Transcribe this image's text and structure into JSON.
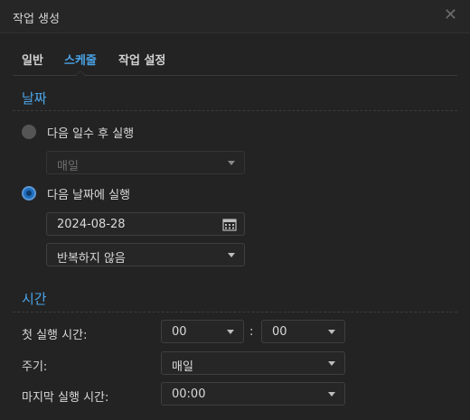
{
  "dialog": {
    "title": "작업 생성",
    "close_glyph": "✕"
  },
  "tabs": [
    {
      "label": "일반",
      "active": false
    },
    {
      "label": "스케줄",
      "active": true
    },
    {
      "label": "작업 설정",
      "active": false
    }
  ],
  "date_section": {
    "title": "날짜",
    "option_days": {
      "label": "다음 일수 후 실행",
      "checked": false,
      "select_value": "매일"
    },
    "option_date": {
      "label": "다음 날짜에 실행",
      "checked": true,
      "date_value": "2024-08-28",
      "repeat_value": "반복하지 않음"
    }
  },
  "time_section": {
    "title": "시간",
    "first_run": {
      "label": "첫 실행 시간:",
      "hour": "00",
      "separator": ":",
      "minute": "00"
    },
    "frequency": {
      "label": "주기:",
      "value": "매일"
    },
    "last_run": {
      "label": "마지막 실행 시간:",
      "value": "00:00"
    }
  },
  "colors": {
    "accent": "#4aa3e6",
    "background": "#232323",
    "radio_checked": "#1f6fbf"
  },
  "icons": {
    "close": "close-icon",
    "calendar": "calendar-icon",
    "dropdown": "chevron-down-icon"
  }
}
